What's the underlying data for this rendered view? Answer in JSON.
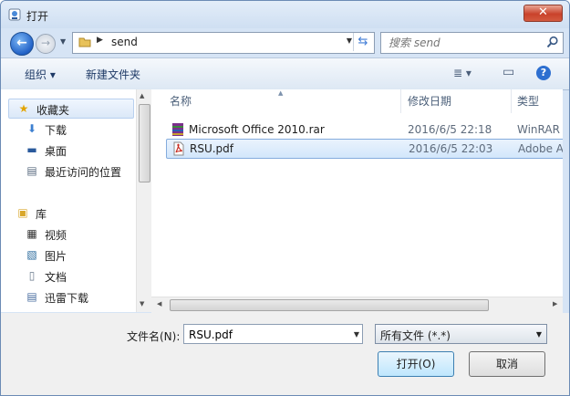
{
  "window": {
    "title": "打开",
    "close_label": "✕"
  },
  "address": {
    "path_segment": "send"
  },
  "search": {
    "placeholder": "搜索 send"
  },
  "toolbar": {
    "organize_label": "组织 ▾",
    "new_folder_label": "新建文件夹",
    "view_icon": "≣ ▾",
    "pane_icon": "▭",
    "help_label": "?"
  },
  "nav": {
    "favorites_label": "收藏夹",
    "favorites": [
      "下载",
      "桌面",
      "最近访问的位置"
    ],
    "library_label": "库",
    "library": [
      "视频",
      "图片",
      "文档",
      "迅雷下载"
    ]
  },
  "columns": {
    "name": "名称",
    "date": "修改日期",
    "type": "类型"
  },
  "files": [
    {
      "name": "Microsoft  Office 2010.rar",
      "date": "2016/6/5 22:18",
      "type": "WinRAR",
      "icon": "rar-archive-icon",
      "selected": false
    },
    {
      "name": "RSU.pdf",
      "date": "2016/6/5 22:03",
      "type": "Adobe A",
      "icon": "pdf-icon",
      "selected": true
    }
  ],
  "footer": {
    "filename_label": "文件名(N):",
    "filename_value": "RSU.pdf",
    "filetype_value": "所有文件 (*.*)",
    "open_label": "打开(O)",
    "cancel_label": "取消"
  },
  "colors": {
    "accent": "#2d6fd0",
    "selection": "#d2e6fb",
    "title_bg": "#d6e4f5"
  }
}
